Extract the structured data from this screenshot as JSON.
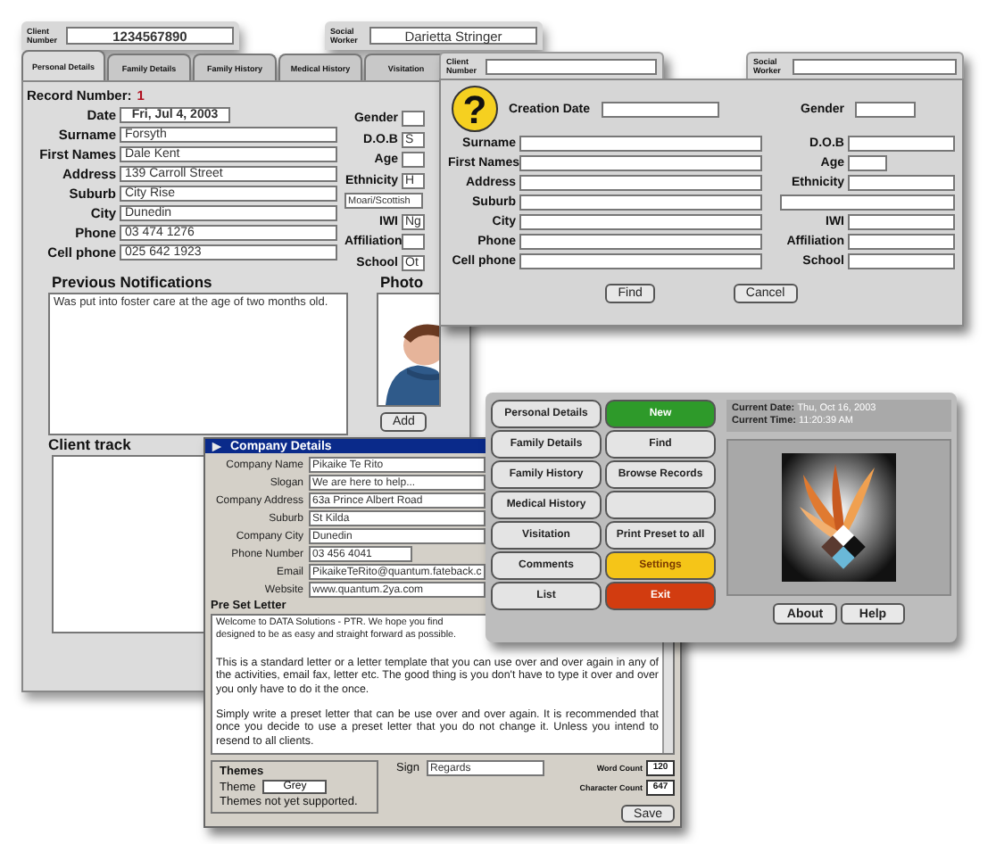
{
  "client_window": {
    "client_number": {
      "label": "Client Number",
      "value": "1234567890"
    },
    "social_worker": {
      "label": "Social Worker",
      "value": "Darietta Stringer"
    },
    "tabs": [
      {
        "label": "Personal Details",
        "selected": true
      },
      {
        "label": "Family Details",
        "selected": false
      },
      {
        "label": "Family History",
        "selected": false
      },
      {
        "label": "Medical History",
        "selected": false
      },
      {
        "label": "Visitation",
        "selected": false
      }
    ],
    "record_label": "Record Number:",
    "record_number": "1",
    "date": {
      "label": "Date",
      "value": "Fri, Jul 4, 2003"
    },
    "fields": [
      {
        "label": "Surname",
        "value": "Forsyth"
      },
      {
        "label": "First Names",
        "value": "Dale Kent"
      },
      {
        "label": "Address",
        "value": "139 Carroll Street"
      },
      {
        "label": "Suburb",
        "value": "City Rise"
      },
      {
        "label": "City",
        "value": "Dunedin"
      },
      {
        "label": "Phone",
        "value": "03 474 1276"
      },
      {
        "label": "Cell phone",
        "value": "025 642 1923"
      }
    ],
    "right_fields": [
      {
        "label": "Gender"
      },
      {
        "label": "D.O.B",
        "value": "S"
      },
      {
        "label": "Age"
      },
      {
        "label": "Ethnicity",
        "value": "H"
      },
      {
        "value": "Moari/Scottish"
      },
      {
        "label": "IWI",
        "value": "Ng"
      },
      {
        "label": "Affiliation"
      },
      {
        "label": "School",
        "value": "Ot"
      }
    ],
    "notifications": {
      "title": "Previous Notifications",
      "text": "Was put into foster care at the age of two months old."
    },
    "photo": {
      "title": "Photo",
      "button": "Add"
    },
    "client_track": {
      "title": "Client track"
    }
  },
  "search_window": {
    "client_number_label": "Client Number",
    "social_worker_label": "Social Worker",
    "icon_glyph": "?",
    "creation_label": "Creation Date",
    "gender_label": "Gender",
    "left_fields": [
      "Surname",
      "First Names",
      "Address",
      "Suburb",
      "City",
      "Phone",
      "Cell phone"
    ],
    "right_fields": [
      {
        "kind": "labeled",
        "label": "D.O.B"
      },
      {
        "kind": "short",
        "label": "Age"
      },
      {
        "kind": "labeled",
        "label": "Ethnicity"
      },
      {
        "kind": "plain"
      },
      {
        "kind": "labeled",
        "label": "IWI"
      },
      {
        "kind": "labeled",
        "label": "Affiliation"
      },
      {
        "kind": "labeled",
        "label": "School"
      }
    ],
    "buttons": [
      "Find",
      "Cancel"
    ]
  },
  "company_window": {
    "title": "Company Details",
    "fields": [
      {
        "label": "Company Name",
        "value": "Pikaike Te Rito"
      },
      {
        "label": "Slogan",
        "value": "We are here to help..."
      },
      {
        "label": "Company Address",
        "value": "63a Prince Albert Road"
      },
      {
        "label": "Suburb",
        "value": "St Kilda"
      },
      {
        "label": "Company City",
        "value": "Dunedin"
      },
      {
        "label": "Phone Number",
        "value": "03 456 4041"
      },
      {
        "label": "Email",
        "value": "PikaikeTeRito@quantum.fateback.c"
      },
      {
        "label": "Website",
        "value": "www.quantum.2ya.com"
      }
    ],
    "letter_title": "Pre Set Letter",
    "letter_lines": [
      "Welcome to DATA Solutions - PTR. We hope you find",
      "designed to be as easy and straight forward as possible."
    ],
    "letter_paragraphs": [
      "This is a standard letter or a letter template that you can use over and over again in any of the activities, email fax, letter etc. The good thing is you don't have to type it over and over you only have to do it the once.",
      "Simply write a preset letter that can be use over and over again. It is recommended that once you decide to use a preset letter that you do not change it. Unless you intend to resend to all clients."
    ],
    "themes": {
      "title": "Themes",
      "label": "Theme",
      "value": "Grey",
      "note": "Themes not yet supported."
    },
    "sign": {
      "label": "Sign",
      "value": "Regards"
    },
    "word_count": {
      "label": "Word Count",
      "value": "120"
    },
    "character_count": {
      "label": "Character Count",
      "value": "647"
    },
    "save": "Save"
  },
  "menu_window": {
    "left_buttons": [
      "Personal Details",
      "Family Details",
      "Family History",
      "Medical History",
      "Visitation",
      "Comments",
      "List"
    ],
    "right_buttons": [
      {
        "label": "New",
        "color": "#2e9a2a"
      },
      {
        "label": "Find",
        "color": "#e4e4e4"
      },
      {
        "label": "Browse Records",
        "color": "#e4e4e4"
      },
      {
        "color": "#e4e4e4"
      },
      {
        "label": "Print Preset to all",
        "color": "#e4e4e4"
      },
      {
        "label": "Settings",
        "color": "#f5c518"
      },
      {
        "label": "Exit",
        "color": "#d23c10"
      }
    ],
    "date_label": "Current Date:",
    "date_value": "Thu, Oct 16, 2003",
    "time_label": "Current Time:",
    "time_value": "11:20:39 AM",
    "buttons": [
      "About",
      "Help"
    ]
  }
}
